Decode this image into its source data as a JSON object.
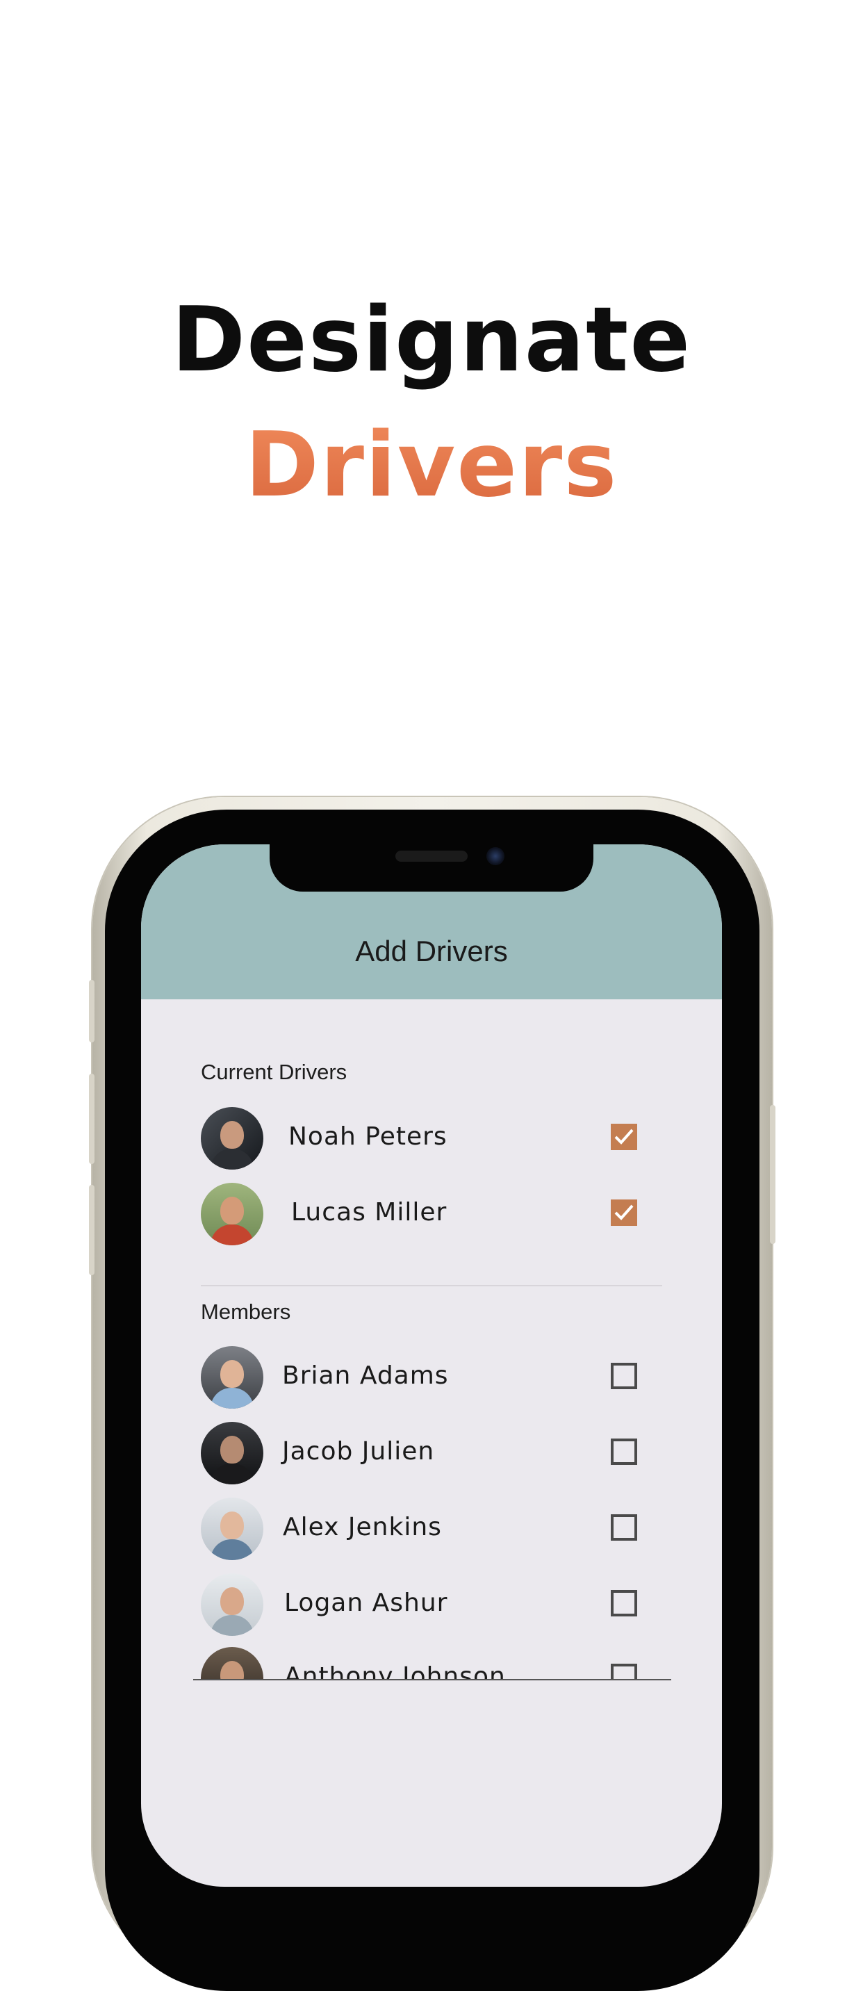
{
  "headline": {
    "part1": "Designate",
    "part2": "Drivers"
  },
  "colors": {
    "accent": "#d9673d",
    "header_bg": "#9dbdbe",
    "checkbox_checked": "#c47d50",
    "screen_bg": "#ebe9ee"
  },
  "app": {
    "title": "Add Drivers",
    "current_drivers_label": "Current Drivers",
    "members_label": "Members",
    "current_drivers": [
      {
        "name": "Noah Peters",
        "checked": true
      },
      {
        "name": "Lucas Miller",
        "checked": true
      }
    ],
    "members": [
      {
        "name": "Brian Adams",
        "checked": false
      },
      {
        "name": "Jacob Julien",
        "checked": false
      },
      {
        "name": "Alex Jenkins",
        "checked": false
      },
      {
        "name": "Logan Ashur",
        "checked": false
      },
      {
        "name": "Anthony Johnson",
        "checked": false
      }
    ]
  },
  "icons": {
    "checkmark": "check-icon"
  }
}
